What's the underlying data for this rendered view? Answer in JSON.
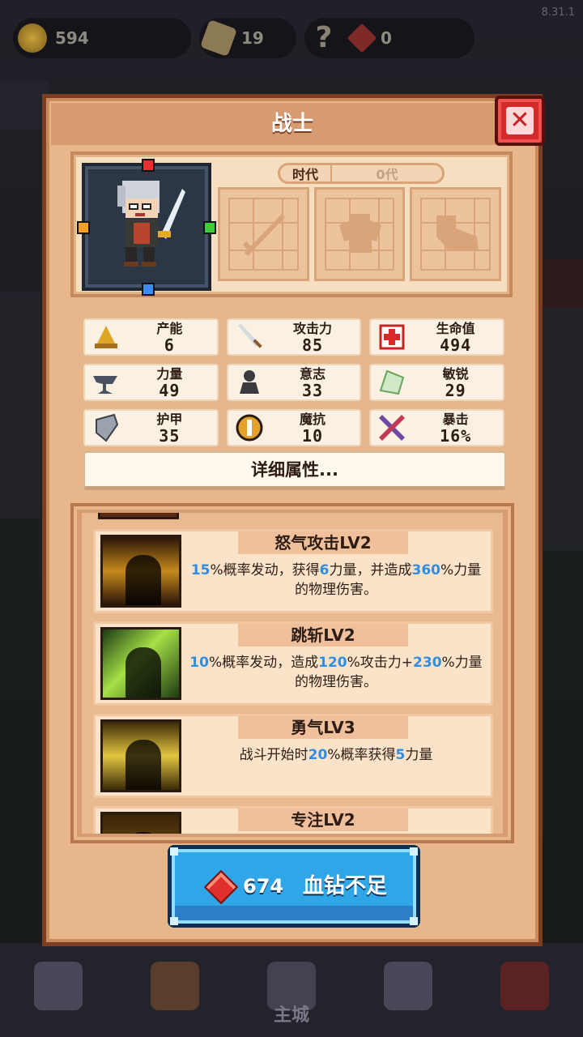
{
  "version": "8.31.1",
  "resources": {
    "coins": "594",
    "food": "19",
    "mystery": "?",
    "gems": "0"
  },
  "bottom_nav": {
    "items": [
      "",
      "",
      "主城",
      "",
      ""
    ]
  },
  "dialog": {
    "title": "战士",
    "close_icon": "close-x-icon",
    "hero": {
      "era_label": "时代",
      "era_value": "0代",
      "equipment_slots": [
        "weapon-slot",
        "armor-slot",
        "boots-slot"
      ]
    },
    "stats": [
      {
        "icon": "production-icon",
        "name": "产能",
        "value": "6"
      },
      {
        "icon": "sword-icon",
        "name": "攻击力",
        "value": "85"
      },
      {
        "icon": "health-cross-icon",
        "name": "生命值",
        "value": "494"
      },
      {
        "icon": "anvil-icon",
        "name": "力量",
        "value": "49"
      },
      {
        "icon": "bust-icon",
        "name": "意志",
        "value": "33"
      },
      {
        "icon": "wing-icon",
        "name": "敏锐",
        "value": "29"
      },
      {
        "icon": "shield-icon",
        "name": "护甲",
        "value": "35"
      },
      {
        "icon": "magic-resist-icon",
        "name": "魔抗",
        "value": "10"
      },
      {
        "icon": "crit-swords-icon",
        "name": "暴击",
        "value": "16%"
      }
    ],
    "detail_button": "详细属性...",
    "skills": [
      {
        "title": "怒气攻击LV2",
        "desc_parts": [
          {
            "t": "15",
            "h": true
          },
          {
            "t": "%概率发动，获得",
            "h": false
          },
          {
            "t": "6",
            "h": true
          },
          {
            "t": "力量，并造成",
            "h": false
          },
          {
            "t": "360",
            "h": true
          },
          {
            "t": "%力量的物理伤害。",
            "h": false
          }
        ]
      },
      {
        "title": "跳斩LV2",
        "desc_parts": [
          {
            "t": "10",
            "h": true
          },
          {
            "t": "%概率发动，造成",
            "h": false
          },
          {
            "t": "120",
            "h": true
          },
          {
            "t": "%攻击力+",
            "h": false
          },
          {
            "t": "230",
            "h": true
          },
          {
            "t": "%力量的物理伤害。",
            "h": false
          }
        ]
      },
      {
        "title": "勇气LV3",
        "desc_parts": [
          {
            "t": "战斗开始时",
            "h": false
          },
          {
            "t": "20",
            "h": true
          },
          {
            "t": "%概率获得",
            "h": false
          },
          {
            "t": "5",
            "h": true
          },
          {
            "t": "力量",
            "h": false
          }
        ]
      },
      {
        "title": "专注LV2",
        "desc_parts": []
      }
    ],
    "buy_button": {
      "cost": "674",
      "label": "血钻不足"
    }
  },
  "colors": {
    "panel": "#e8b68b",
    "highlight": "#2f8de4",
    "close": "#d32a2a",
    "buy": "#2ea6e8"
  }
}
